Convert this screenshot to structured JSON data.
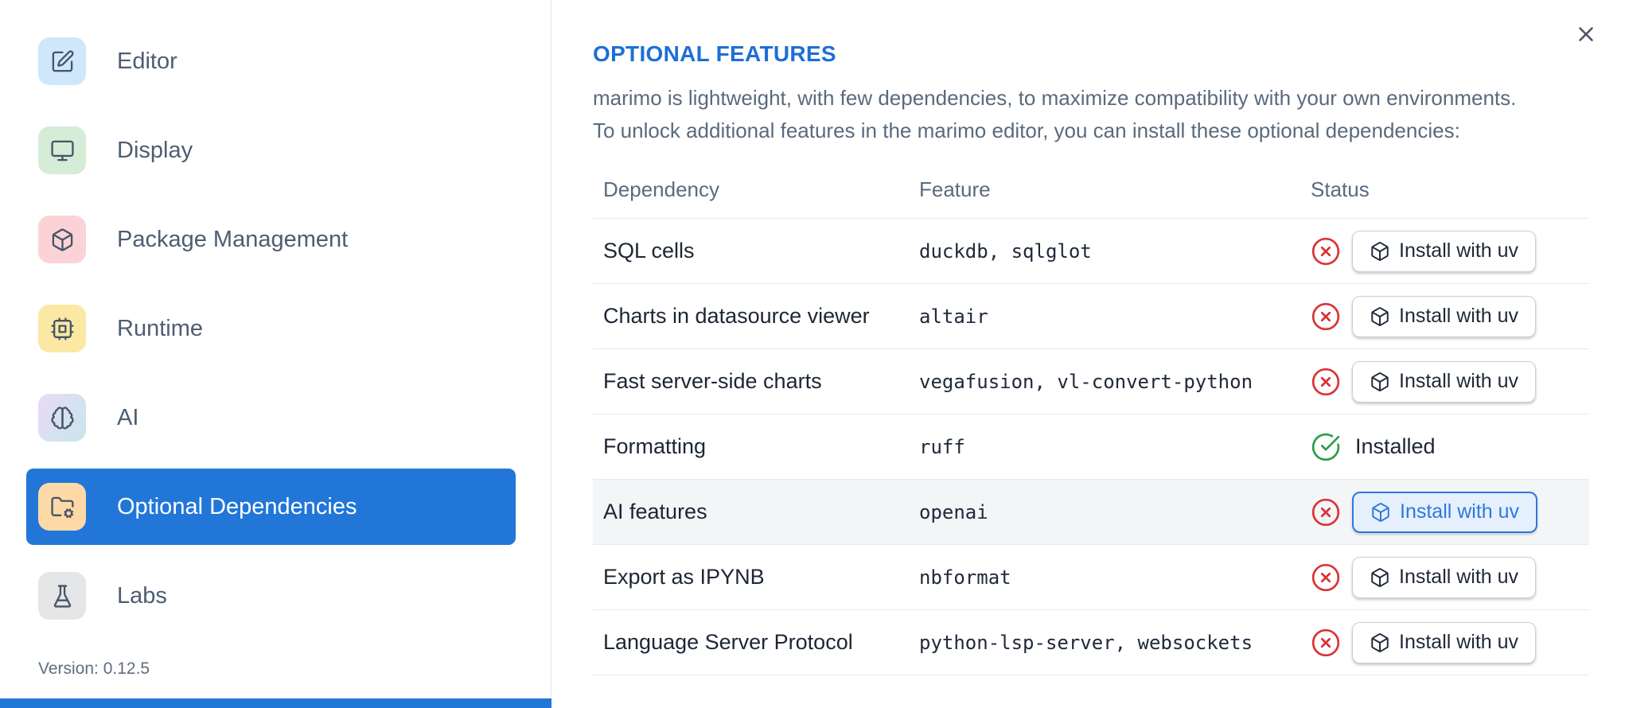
{
  "sidebar": {
    "items": [
      {
        "label": "Editor",
        "icon": "square-pen-icon",
        "icon_bg": "#cfe7fa",
        "selected": false
      },
      {
        "label": "Display",
        "icon": "monitor-icon",
        "icon_bg": "#d5ecd6",
        "selected": false
      },
      {
        "label": "Package Management",
        "icon": "box-icon",
        "icon_bg": "#fbd3d6",
        "selected": false
      },
      {
        "label": "Runtime",
        "icon": "cpu-icon",
        "icon_bg": "#fbe8a3",
        "selected": false
      },
      {
        "label": "AI",
        "icon": "brain-icon",
        "icon_bg": "linear-gradient(120deg,#ead9f4 0%,#d5e2f2 55%,#cbe5e8 100%)",
        "selected": false
      },
      {
        "label": "Optional Dependencies",
        "icon": "folder-cog-icon",
        "icon_bg": "#fcd9a6",
        "selected": true
      },
      {
        "label": "Labs",
        "icon": "flask-icon",
        "icon_bg": "#e5e6e8",
        "selected": false
      }
    ],
    "version_label": "Version: 0.12.5"
  },
  "panel": {
    "title": "OPTIONAL FEATURES",
    "description_line1": "marimo is lightweight, with few dependencies, to maximize compatibility with your own environments.",
    "description_line2": "To unlock additional features in the marimo editor, you can install these optional dependencies:"
  },
  "table": {
    "columns": [
      "Dependency",
      "Feature",
      "Status"
    ],
    "install_button_label": "Install with uv",
    "installed_label": "Installed",
    "rows": [
      {
        "dependency": "SQL cells",
        "feature": "duckdb, sqlglot",
        "installed": false,
        "highlighted": false
      },
      {
        "dependency": "Charts in datasource viewer",
        "feature": "altair",
        "installed": false,
        "highlighted": false
      },
      {
        "dependency": "Fast server-side charts",
        "feature": "vegafusion, vl-convert-python",
        "installed": false,
        "highlighted": false
      },
      {
        "dependency": "Formatting",
        "feature": "ruff",
        "installed": true,
        "highlighted": false
      },
      {
        "dependency": "AI features",
        "feature": "openai",
        "installed": false,
        "highlighted": true
      },
      {
        "dependency": "Export as IPYNB",
        "feature": "nbformat",
        "installed": false,
        "highlighted": false
      },
      {
        "dependency": "Language Server Protocol",
        "feature": "python-lsp-server, websockets",
        "installed": false,
        "highlighted": false
      }
    ]
  },
  "colors": {
    "accent_blue": "#2176d8",
    "title_blue": "#1d6fd6",
    "status_red": "#da3333",
    "status_green": "#2b9e47",
    "highlight_row_bg": "#f4f5f7",
    "primary_button_bg": "#e6effc",
    "primary_button_border": "#2c79dd"
  }
}
